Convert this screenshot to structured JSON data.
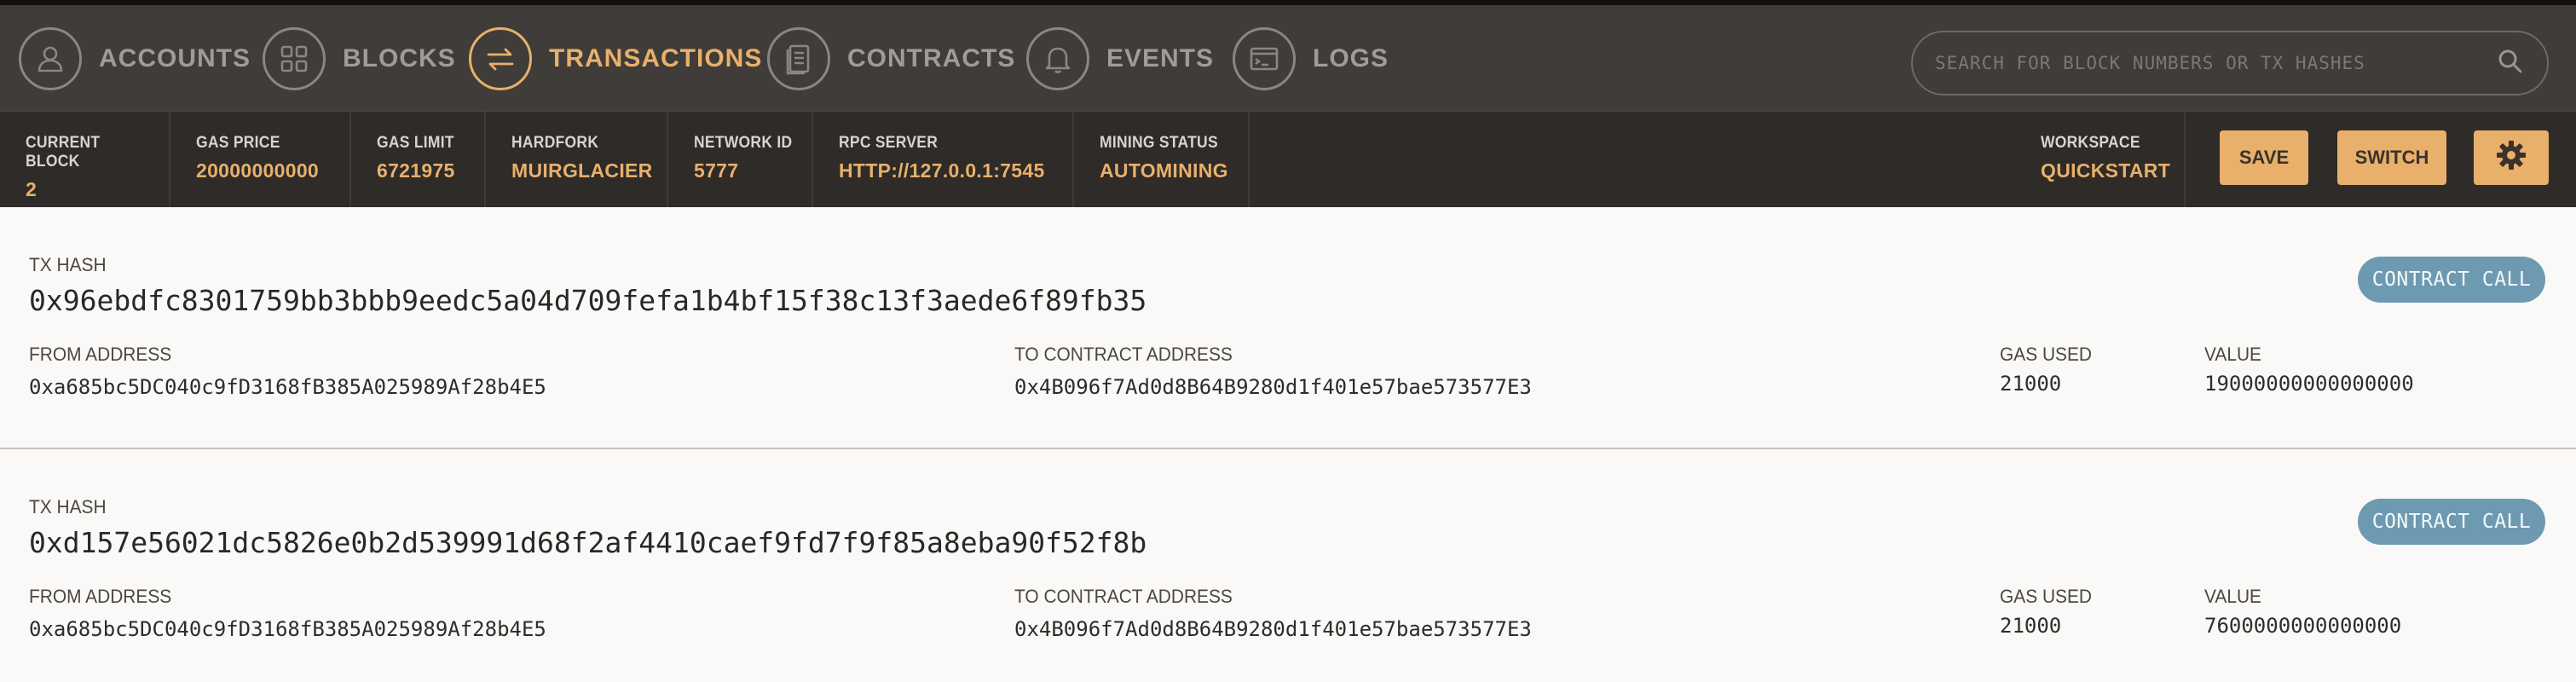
{
  "nav": {
    "items": [
      {
        "label": "ACCOUNTS",
        "icon": "user-icon",
        "active": false
      },
      {
        "label": "BLOCKS",
        "icon": "blocks-icon",
        "active": false
      },
      {
        "label": "TRANSACTIONS",
        "icon": "transfer-arrows-icon",
        "active": true
      },
      {
        "label": "CONTRACTS",
        "icon": "document-icon",
        "active": false
      },
      {
        "label": "EVENTS",
        "icon": "bell-icon",
        "active": false
      },
      {
        "label": "LOGS",
        "icon": "terminal-icon",
        "active": false
      }
    ],
    "search_placeholder": "SEARCH FOR BLOCK NUMBERS OR TX HASHES"
  },
  "status": {
    "current_block": {
      "label": "CURRENT BLOCK",
      "value": "2"
    },
    "gas_price": {
      "label": "GAS PRICE",
      "value": "20000000000"
    },
    "gas_limit": {
      "label": "GAS LIMIT",
      "value": "6721975"
    },
    "hardfork": {
      "label": "HARDFORK",
      "value": "MUIRGLACIER"
    },
    "network_id": {
      "label": "NETWORK ID",
      "value": "5777"
    },
    "rpc_server": {
      "label": "RPC SERVER",
      "value": "HTTP://127.0.0.1:7545"
    },
    "mining_status": {
      "label": "MINING STATUS",
      "value": "AUTOMINING"
    },
    "workspace": {
      "label": "WORKSPACE",
      "value": "QUICKSTART"
    },
    "save_label": "SAVE",
    "switch_label": "SWITCH"
  },
  "labels": {
    "tx_hash": "TX HASH",
    "from_address": "FROM ADDRESS",
    "to_contract_address": "TO CONTRACT ADDRESS",
    "gas_used": "GAS USED",
    "value": "VALUE"
  },
  "transactions": [
    {
      "hash": "0x96ebdfc8301759bb3bbb9eedc5a04d709fefa1b4bf15f38c13f3aede6f89fb35",
      "from": "0xa685bc5DC040c9fD3168fB385A025989Af28b4E5",
      "to": "0x4B096f7Ad0d8B64B9280d1f401e57bae573577E3",
      "gas_used": "21000",
      "value": "19000000000000000",
      "type": "CONTRACT CALL"
    },
    {
      "hash": "0xd157e56021dc5826e0b2d539991d68f2af4410caef9fd7f9f85a8eba90f52f8b",
      "from": "0xa685bc5DC040c9fD3168fB385A025989Af28b4E5",
      "to": "0x4B096f7Ad0d8B64B9280d1f401e57bae573577E3",
      "gas_used": "21000",
      "value": "7600000000000000",
      "type": "CONTRACT CALL"
    }
  ],
  "colors": {
    "accent": "#e8b06a",
    "nav_bg": "#3f3c39",
    "status_bg": "#2e2b29",
    "badge": "#6d9ab1"
  }
}
